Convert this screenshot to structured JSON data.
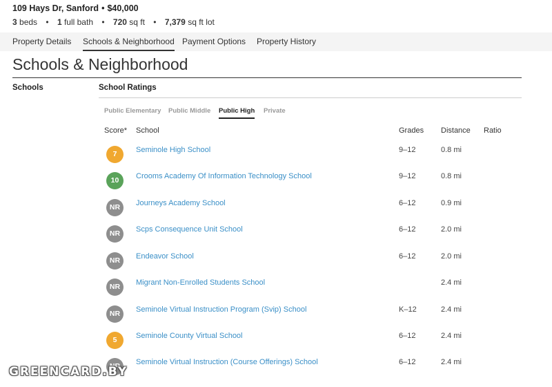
{
  "header": {
    "address": "109 Hays Dr, Sanford",
    "separator": "•",
    "price": "$40,000",
    "beds_value": "3",
    "beds_label": " beds",
    "baths_value": "1",
    "baths_label": " full bath",
    "sqft_value": "720",
    "sqft_label": " sq ft",
    "lot_value": "7,379",
    "lot_label": " sq ft lot"
  },
  "tabs": [
    {
      "label": "Property Details"
    },
    {
      "label": "Schools & Neighborhood",
      "active": true
    },
    {
      "label": "Payment Options"
    },
    {
      "label": "Property History"
    }
  ],
  "page_title": "Schools & Neighborhood",
  "side_label": "Schools",
  "section_label": "School Ratings",
  "subtabs": [
    {
      "label": "Public Elementary"
    },
    {
      "label": "Public Middle"
    },
    {
      "label": "Public High",
      "active": true
    },
    {
      "label": "Private"
    }
  ],
  "table": {
    "headers": {
      "score": "Score*",
      "school": "School",
      "grades": "Grades",
      "distance": "Distance",
      "ratio": "Ratio"
    },
    "rows": [
      {
        "score": "7",
        "color": "#f0a830",
        "school": "Seminole High School",
        "grades": "9–12",
        "distance": "0.8 mi"
      },
      {
        "score": "10",
        "color": "#5aa35a",
        "school": "Crooms Academy Of Information Technology School",
        "grades": "9–12",
        "distance": "0.8 mi"
      },
      {
        "score": "NR",
        "color": "#8e8e8e",
        "school": "Journeys Academy School",
        "grades": "6–12",
        "distance": "0.9 mi"
      },
      {
        "score": "NR",
        "color": "#8e8e8e",
        "school": "Scps Consequence Unit School",
        "grades": "6–12",
        "distance": "2.0 mi"
      },
      {
        "score": "NR",
        "color": "#8e8e8e",
        "school": "Endeavor School",
        "grades": "6–12",
        "distance": "2.0 mi"
      },
      {
        "score": "NR",
        "color": "#8e8e8e",
        "school": "Migrant Non-Enrolled Students School",
        "grades": "",
        "distance": "2.4 mi"
      },
      {
        "score": "NR",
        "color": "#8e8e8e",
        "school": "Seminole Virtual Instruction Program (Svip) School",
        "grades": "K–12",
        "distance": "2.4 mi"
      },
      {
        "score": "5",
        "color": "#f0a830",
        "school": "Seminole County Virtual School",
        "grades": "6–12",
        "distance": "2.4 mi"
      },
      {
        "score": "NR",
        "color": "#8e8e8e",
        "school": "Seminole Virtual Instruction (Course Offerings) School",
        "grades": "6–12",
        "distance": "2.4 mi"
      }
    ]
  },
  "watermark": "GREENCARD.BY"
}
